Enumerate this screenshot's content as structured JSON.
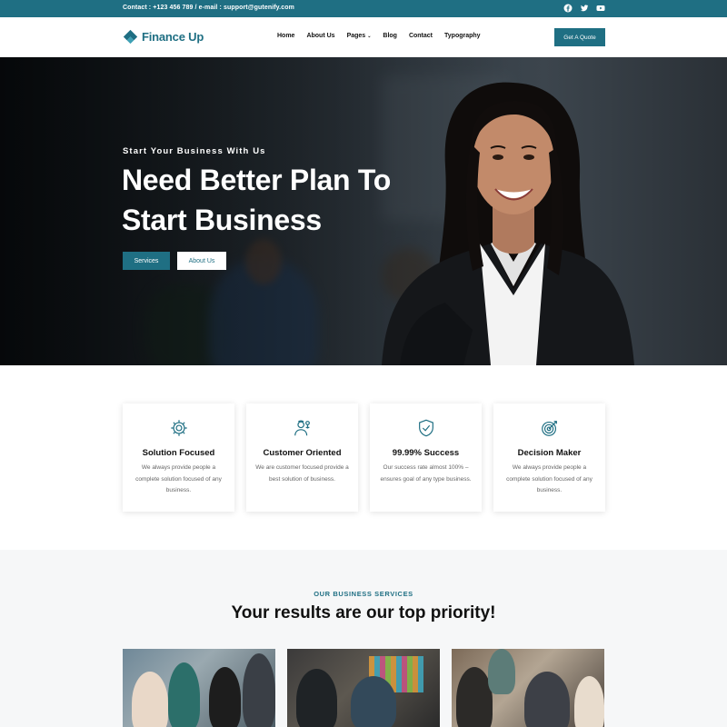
{
  "topbar": {
    "contact_text": "Contact : +123 456 789  /  e-mail : support@gutenify.com",
    "social": [
      "facebook-icon",
      "twitter-icon",
      "youtube-icon"
    ]
  },
  "nav": {
    "logo_text": "Finance Up",
    "items": [
      "Home",
      "About Us",
      "Pages",
      "Blog",
      "Contact",
      "Typography"
    ],
    "cta": "Get A Quote"
  },
  "hero": {
    "subtitle": "Start Your Business With Us",
    "title_line1": "Need Better Plan To",
    "title_line2": "Start Business",
    "btn_primary": "Services",
    "btn_secondary": "About Us"
  },
  "features": [
    {
      "icon": "gear-icon",
      "title": "Solution Focused",
      "desc": "We always provide people a complete solution focused of any business."
    },
    {
      "icon": "customer-icon",
      "title": "Customer Oriented",
      "desc": "We are customer focused provide a best solution of business."
    },
    {
      "icon": "shield-check-icon",
      "title": "99.99% Success",
      "desc": "Our success rate almost 100% – ensures goal of any type business."
    },
    {
      "icon": "target-icon",
      "title": "Decision Maker",
      "desc": "We always provide people a complete solution focused of any business."
    }
  ],
  "services": {
    "label": "OUR BUSINESS SERVICES",
    "title": "Your results are our top priority!"
  },
  "colors": {
    "brand": "#1f6f83",
    "topbar_bg": "#1f6f83",
    "section_bg": "#f6f7f8"
  }
}
